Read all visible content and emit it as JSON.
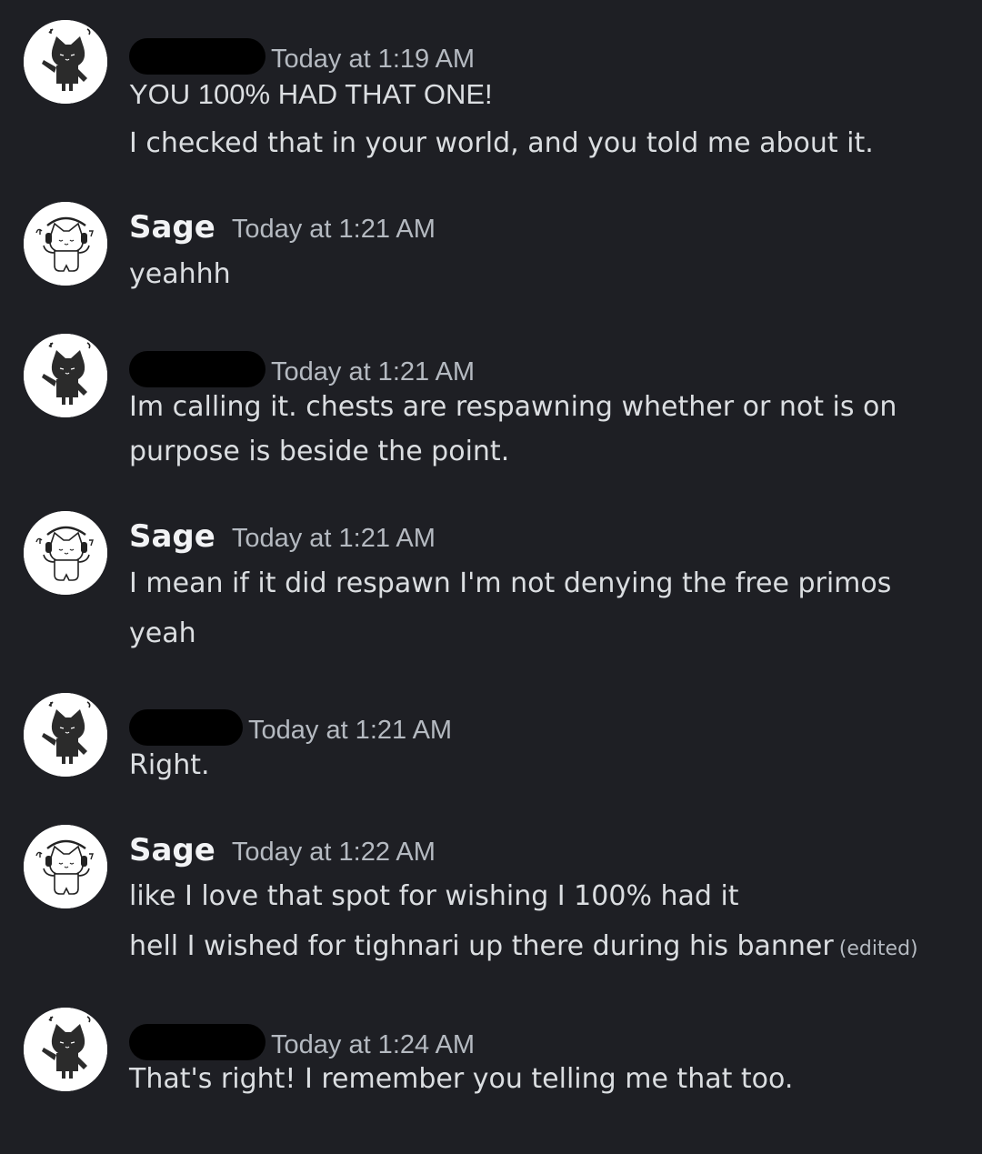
{
  "messages": [
    {
      "author": "",
      "timestamp": "Today at 1:19 AM",
      "avatar_icon": "black-cat-icon",
      "lines": [
        "YOU 100% HAD THAT ONE!",
        "I checked that in your world, and you told me about it."
      ]
    },
    {
      "author": "Sage",
      "timestamp": "Today at 1:21 AM",
      "avatar_icon": "white-cat-headphones-icon",
      "lines": [
        "yeahhh"
      ]
    },
    {
      "author": "",
      "timestamp": "Today at 1:21 AM",
      "avatar_icon": "black-cat-icon",
      "lines": [
        "Im calling it. chests are respawning whether or not is on",
        "purpose is beside the point."
      ]
    },
    {
      "author": "Sage",
      "timestamp": "Today at 1:21 AM",
      "avatar_icon": "white-cat-headphones-icon",
      "lines": [
        "I mean if it did respawn I'm not denying the free primos",
        "yeah"
      ]
    },
    {
      "author": "",
      "timestamp": "Today at 1:21 AM",
      "avatar_icon": "black-cat-icon",
      "lines": [
        "Right."
      ]
    },
    {
      "author": "Sage",
      "timestamp": "Today at 1:22 AM",
      "avatar_icon": "white-cat-headphones-icon",
      "lines": [
        "like I love that spot for wishing I 100% had it",
        "hell I wished for tighnari up there during his banner"
      ],
      "edited_label": "(edited)"
    },
    {
      "author": "",
      "timestamp": "Today at 1:24 AM",
      "avatar_icon": "black-cat-icon",
      "lines": [
        "That's right! I remember you telling me that too."
      ]
    }
  ],
  "colors": {
    "background": "#1e1f24",
    "text": "#dbdee1",
    "username": "#f2f3f5",
    "timestamp": "#b5bac1",
    "redaction": "#000000"
  }
}
